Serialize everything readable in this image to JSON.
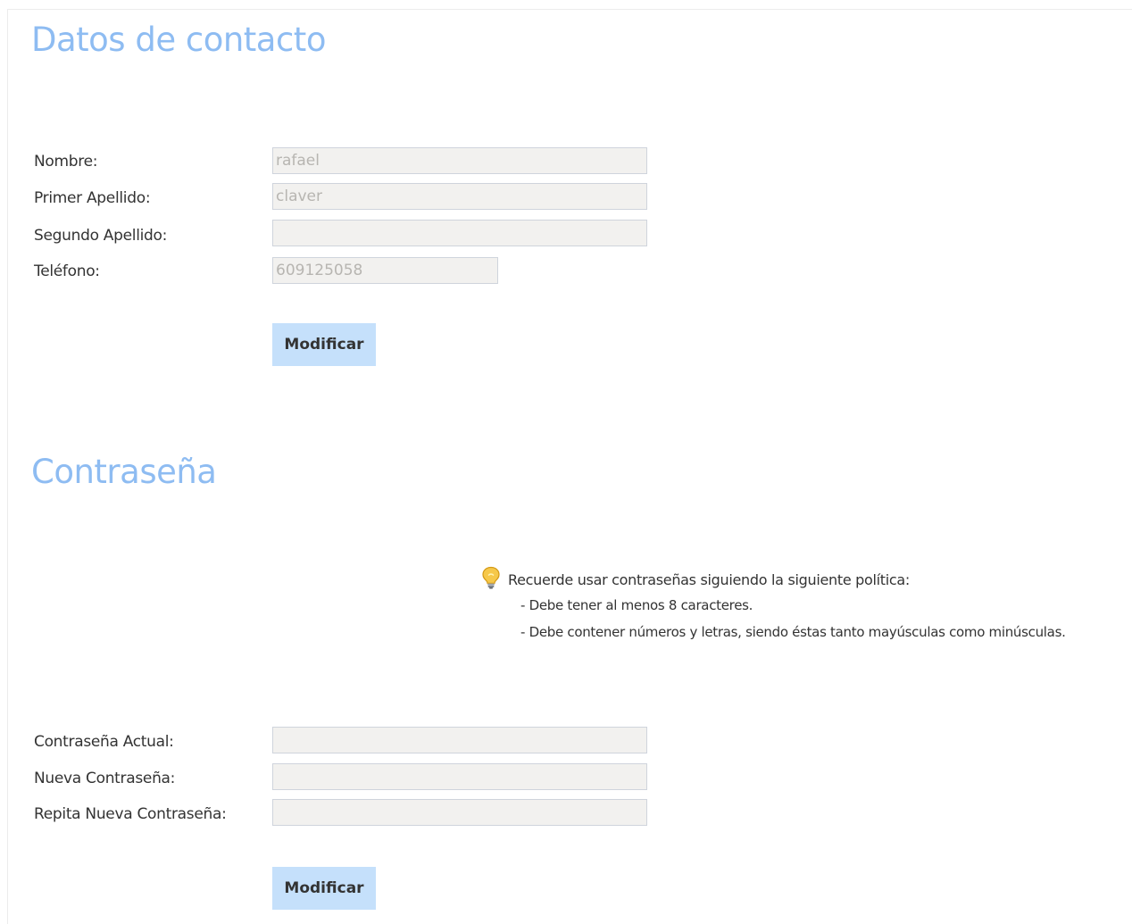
{
  "contact": {
    "title": "Datos de contacto",
    "fields": [
      {
        "label": "Nombre:",
        "value": "rafael"
      },
      {
        "label": "Primer Apellido:",
        "value": "claver"
      },
      {
        "label": "Segundo Apellido:",
        "value": ""
      },
      {
        "label": "Teléfono:",
        "value": "609125058"
      }
    ],
    "submit_label": "Modificar"
  },
  "password": {
    "title": "Contraseña",
    "tip": {
      "icon": "lightbulb-icon",
      "heading": "Recuerde usar contraseñas siguiendo la siguiente política:",
      "rules": [
        "- Debe tener al menos 8 caracteres.",
        "- Debe contener números y letras, siendo éstas tanto mayúsculas como minúsculas."
      ]
    },
    "fields": [
      {
        "label": "Contraseña Actual:",
        "value": ""
      },
      {
        "label": "Nueva Contraseña:",
        "value": ""
      },
      {
        "label": "Repita Nueva Contraseña:",
        "value": ""
      }
    ],
    "submit_label": "Modificar"
  },
  "colors": {
    "heading": "#8ebcf2",
    "button_bg": "#c5e0fb",
    "field_bg": "#f2f1ef",
    "field_text": "#b7b5b1"
  }
}
